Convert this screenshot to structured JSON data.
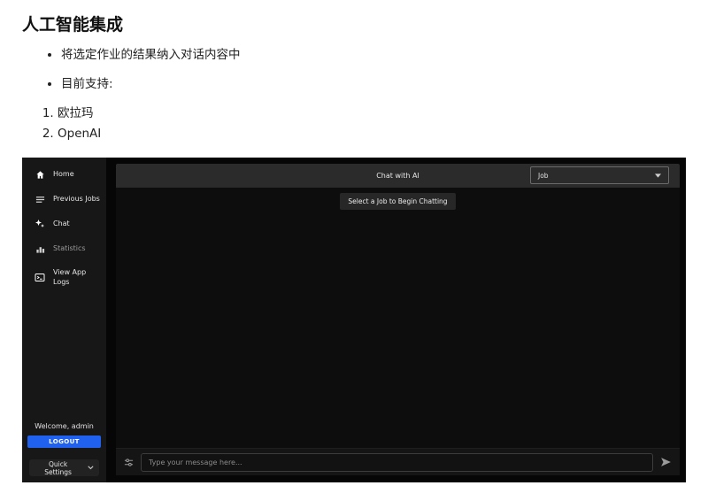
{
  "document": {
    "heading": "人工智能集成",
    "bullets": [
      "将选定作业的结果纳入对话内容中",
      "目前支持:"
    ],
    "numbered_list": [
      "欧拉玛",
      "OpenAI"
    ]
  },
  "app": {
    "sidebar": {
      "nav_items": [
        {
          "label": "Home",
          "icon": "home-icon"
        },
        {
          "label": "Previous Jobs",
          "icon": "history-icon"
        },
        {
          "label": "Chat",
          "icon": "ai-sparkle-icon"
        },
        {
          "label": "Statistics",
          "icon": "bar-chart-icon"
        },
        {
          "label": "View App Logs",
          "icon": "app-logs-icon"
        }
      ],
      "welcome_text": "Welcome, admin",
      "logout_button": "LOGOUT",
      "quick_settings_button": "Quick Settings"
    },
    "header": {
      "title": "Chat with AI",
      "job_select_value": "Job"
    },
    "chat": {
      "empty_state_button": "Select a Job to Begin Chatting"
    },
    "composer": {
      "placeholder": "Type your message here...",
      "left_icon": "tune-icon",
      "send_icon": "send-icon"
    },
    "colors": {
      "accent_blue": "#2161f0",
      "sidebar_bg": "#171717",
      "header_bg": "#2b2b2b",
      "chat_bg": "#0d0d0d"
    }
  }
}
